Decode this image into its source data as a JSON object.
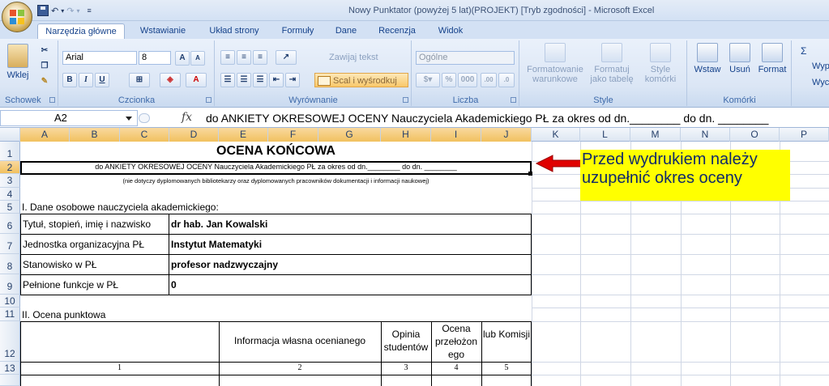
{
  "window": {
    "title": "Nowy Punktator (powyżej 5 lat)(PROJEKT)  [Tryb zgodności]  -  Microsoft Excel"
  },
  "tabs": [
    "Narzędzia główne",
    "Wstawianie",
    "Układ strony",
    "Formuły",
    "Dane",
    "Recenzja",
    "Widok"
  ],
  "ribbon": {
    "schowek": {
      "label": "Schowek",
      "paste": "Wklej"
    },
    "czcionka": {
      "label": "Czcionka",
      "font": "Arial",
      "size": "8"
    },
    "wyrownanie": {
      "label": "Wyrównanie",
      "wrap": "Zawijaj tekst",
      "merge": "Scal i wyśrodkuj"
    },
    "liczba": {
      "label": "Liczba",
      "format": "Ogólne"
    },
    "style": {
      "label": "Style",
      "cond": "Formatowanie warunkowe",
      "table": "Formatuj jako tabelę",
      "cell": "Style komórki"
    },
    "komorki": {
      "label": "Komórki",
      "insert": "Wstaw",
      "delete": "Usuń",
      "format": "Format"
    },
    "extra": {
      "sigma": "Σ",
      "w1": "Wyp",
      "w2": "Wyc"
    }
  },
  "formula_bar": {
    "name_box": "A2",
    "fx": "fx",
    "content": "do ANKIETY OKRESOWEJ OCENY Nauczyciela Akademickiego PŁ za okres od dn.________ do dn. ________"
  },
  "columns": [
    "A",
    "B",
    "C",
    "D",
    "E",
    "F",
    "G",
    "H",
    "I",
    "J",
    "K",
    "L",
    "M",
    "N",
    "O",
    "P"
  ],
  "rows": [
    "1",
    "2",
    "3",
    "4",
    "5",
    "6",
    "7",
    "8",
    "9",
    "10",
    "11",
    "12",
    "13"
  ],
  "sheet": {
    "title": "OCENA KOŃCOWA",
    "subtitle": "do ANKIETY OKRESOWEJ OCENY Nauczyciela Akademickiego PŁ za okres od dn.________ do dn. ________",
    "note_small": "(nie dotyczy dyplomowanych bibliotekarzy oraz dyplomowanych pracowników  dokumentacji i informacji naukowej)",
    "section1": "I. Dane osobowe nauczyciela akademickiego:",
    "personal": [
      {
        "label": "Tytuł, stopień, imię i nazwisko",
        "value": "dr hab. Jan Kowalski"
      },
      {
        "label": "Jednostka organizacyjna PŁ",
        "value": "Instytut Matematyki"
      },
      {
        "label": "Stanowisko w PŁ",
        "value": "profesor nadzwyczajny"
      },
      {
        "label": "Pełnione funkcje w PŁ",
        "value": "0"
      }
    ],
    "section2": "II. Ocena punktowa",
    "table_headers": [
      "Informacja własna ocenianego",
      "Opinia studentów",
      "Ocena przełożon ego",
      "lub Komisji"
    ],
    "table_numbers": [
      "1",
      "2",
      "3",
      "4",
      "5"
    ]
  },
  "callout": {
    "line1": "Przed wydrukiem należy",
    "line2": "uzupełnić okres oceny",
    "arrow_color": "#e00000",
    "bg": "#ffff00"
  }
}
